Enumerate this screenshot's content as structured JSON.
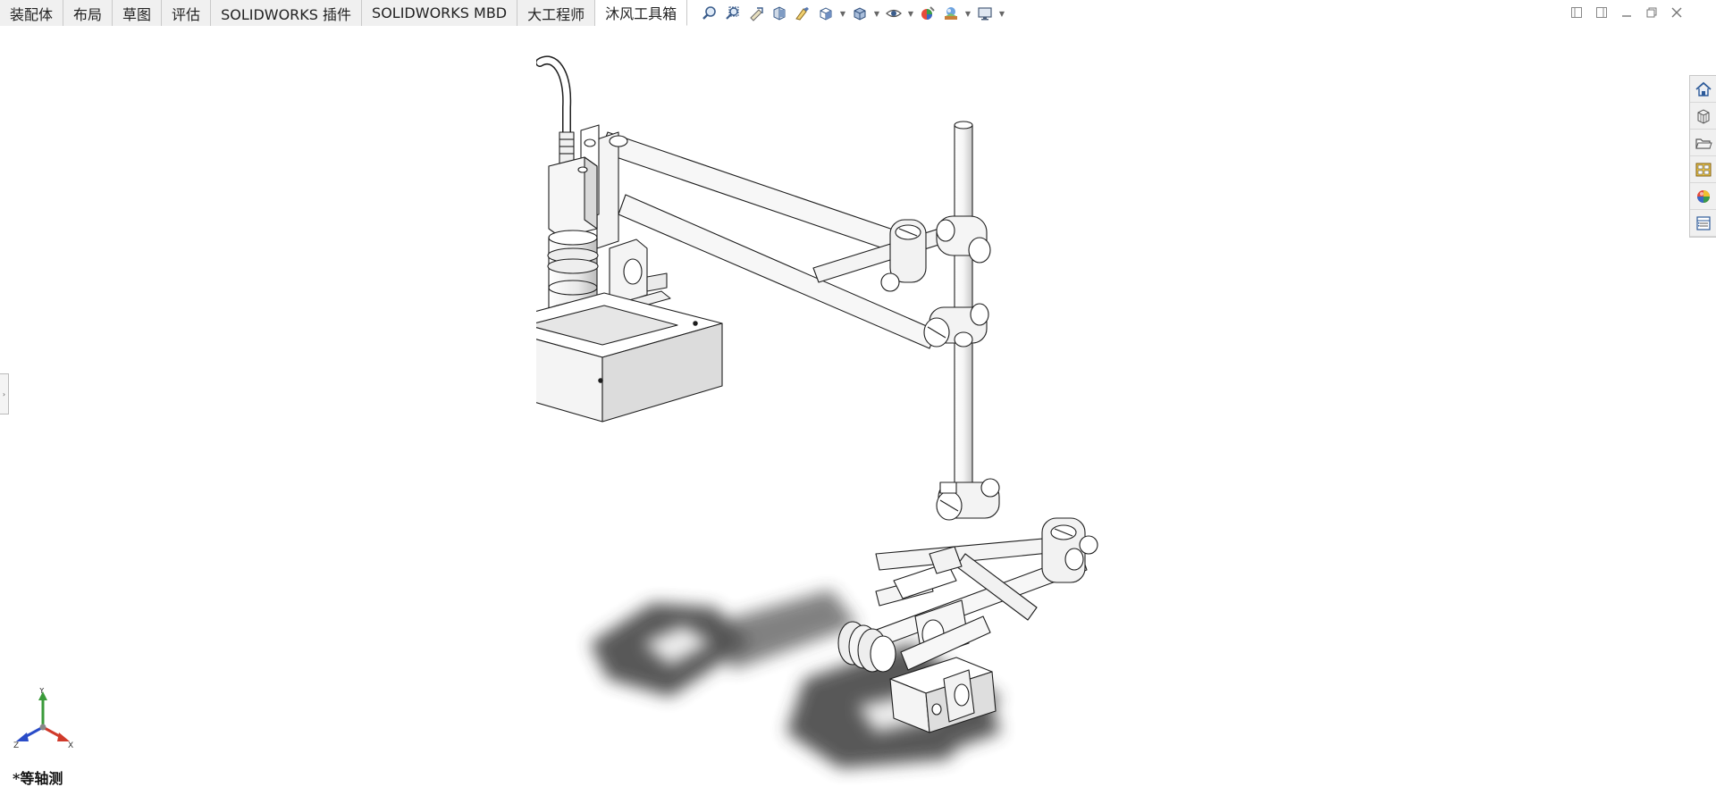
{
  "tabs": [
    {
      "label": "装配体"
    },
    {
      "label": "布局"
    },
    {
      "label": "草图"
    },
    {
      "label": "评估"
    },
    {
      "label": "SOLIDWORKS 插件"
    },
    {
      "label": "SOLIDWORKS MBD"
    },
    {
      "label": "大工程师"
    },
    {
      "label": "沐风工具箱"
    }
  ],
  "active_tab": "沐风工具箱",
  "view_toolbar": [
    "zoom-to-fit-icon",
    "zoom-to-area-icon",
    "previous-view-icon",
    "section-view-icon",
    "dynamic-annotation-icon",
    "view-orientation-icon",
    "display-style-icon",
    "hide-show-items-icon",
    "edit-appearance-icon",
    "apply-scene-icon",
    "view-settings-icon"
  ],
  "task_pane": [
    "home-icon",
    "design-library-icon",
    "file-explorer-icon",
    "view-palette-icon",
    "appearances-icon",
    "custom-properties-icon"
  ],
  "triad": {
    "x": "X",
    "y": "Y",
    "z": "Z"
  },
  "view_label": "*等轴测",
  "colors": {
    "x_axis": "#d03a2a",
    "y_axis": "#3a9a3a",
    "z_axis": "#2a4cc8"
  }
}
